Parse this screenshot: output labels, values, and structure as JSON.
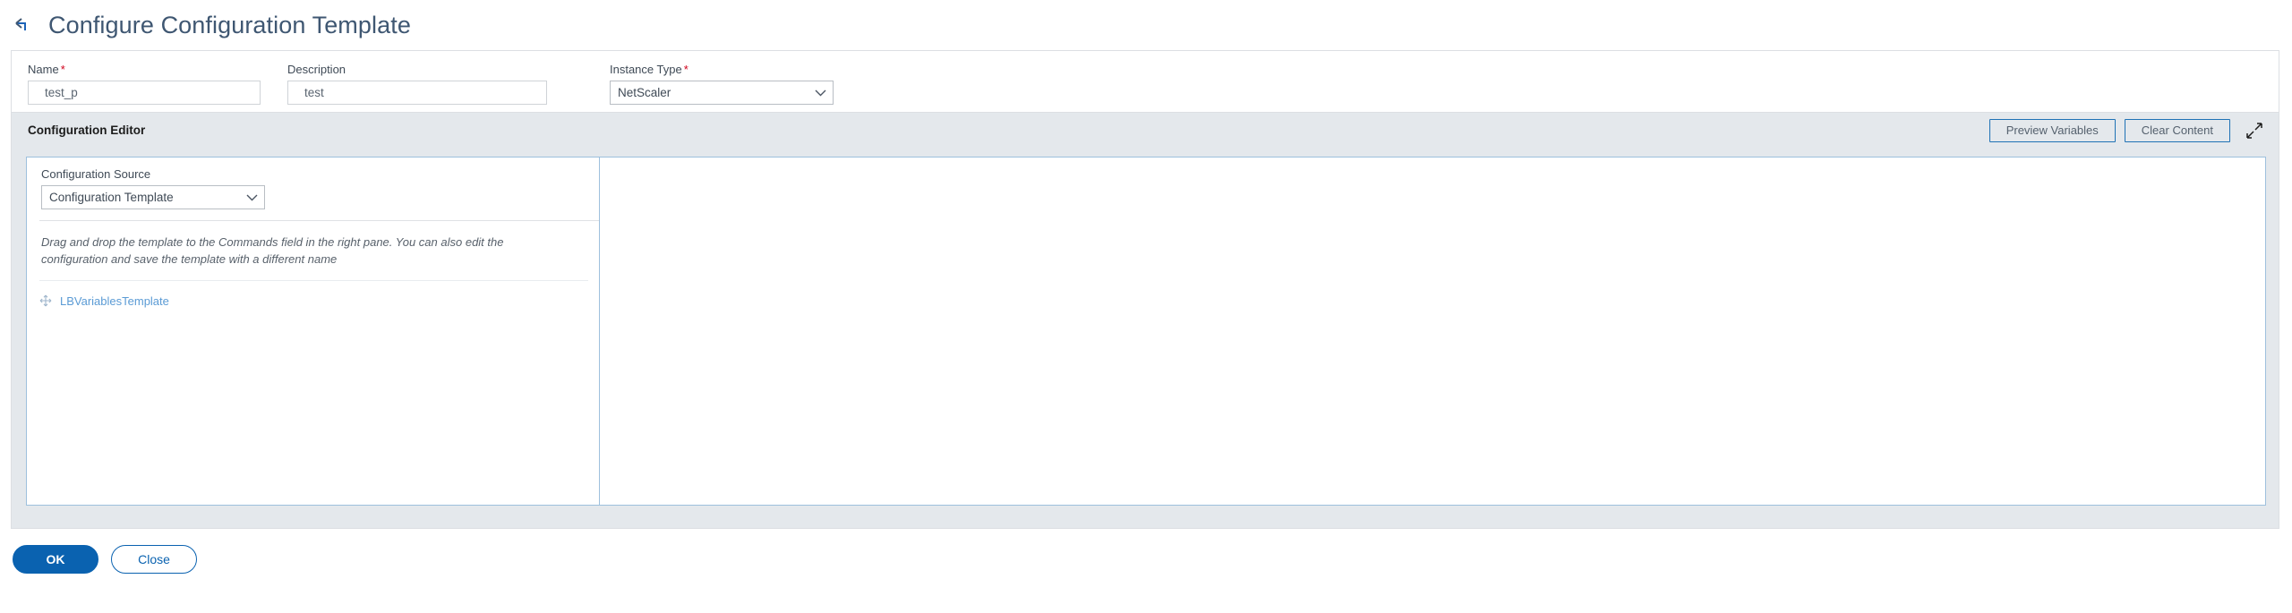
{
  "header": {
    "back_icon": "back-arrow-icon",
    "title": "Configure Configuration Template"
  },
  "form": {
    "name": {
      "label": "Name",
      "required_marker": "*",
      "value": "test_p"
    },
    "description": {
      "label": "Description",
      "value": "test"
    },
    "instance_type": {
      "label": "Instance Type",
      "required_marker": "*",
      "value": "NetScaler",
      "chevron_icon": "chevron-down-icon"
    }
  },
  "editor": {
    "title": "Configuration Editor",
    "preview_variables_label": "Preview Variables",
    "clear_content_label": "Clear Content",
    "expand_icon": "expand-diagonal-icon",
    "source": {
      "label": "Configuration Source",
      "value": "Configuration Template",
      "chevron_icon": "chevron-down-icon"
    },
    "hint": "Drag and drop the template to the Commands field in the right pane. You can also edit the configuration and save the template with a different name",
    "templates": [
      {
        "label": "LBVariablesTemplate",
        "move_icon": "move-arrows-icon"
      }
    ]
  },
  "footer": {
    "ok_label": "OK",
    "close_label": "Close"
  },
  "colors": {
    "accent_blue": "#0a62b0",
    "title_slate": "#3f5772",
    "required_red": "#d0021b",
    "bar_gray": "#e4e8ec",
    "link_blue": "#5b9bd5",
    "pane_border": "#9dc0dd"
  }
}
